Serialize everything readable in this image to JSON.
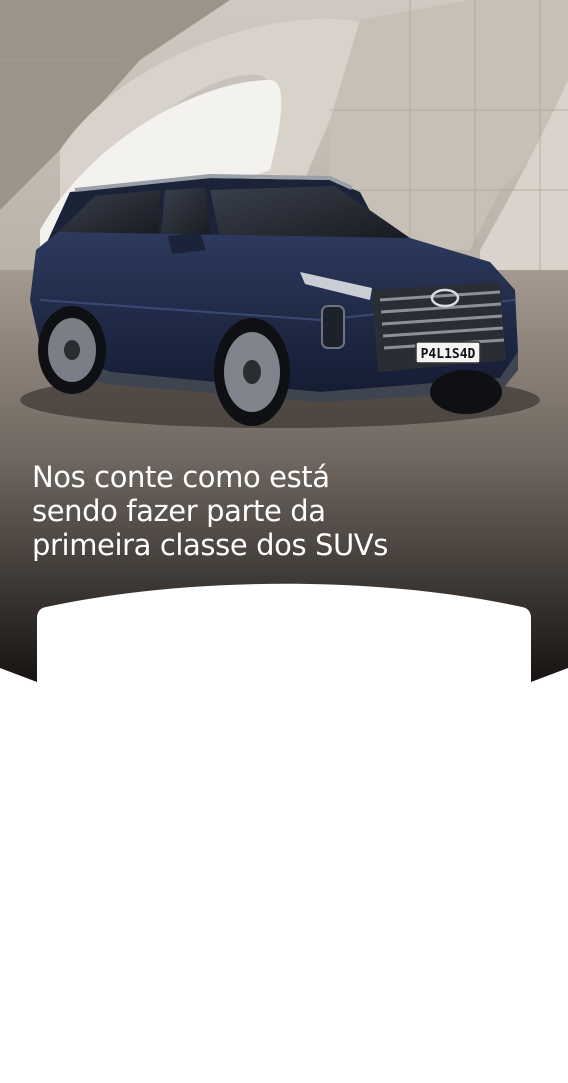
{
  "hero": {
    "headline_lines": [
      "Nos conte como está",
      "sendo fazer parte da",
      "primeira classe dos SUVs"
    ],
    "license_plate": "P4L1S4D",
    "image_icon": "suv-car-photo"
  },
  "colors": {
    "headline": "#ffffff",
    "card_background": "#ffffff",
    "car_body": "#1f2a4a",
    "hero_dark": "#0f0d0c"
  }
}
